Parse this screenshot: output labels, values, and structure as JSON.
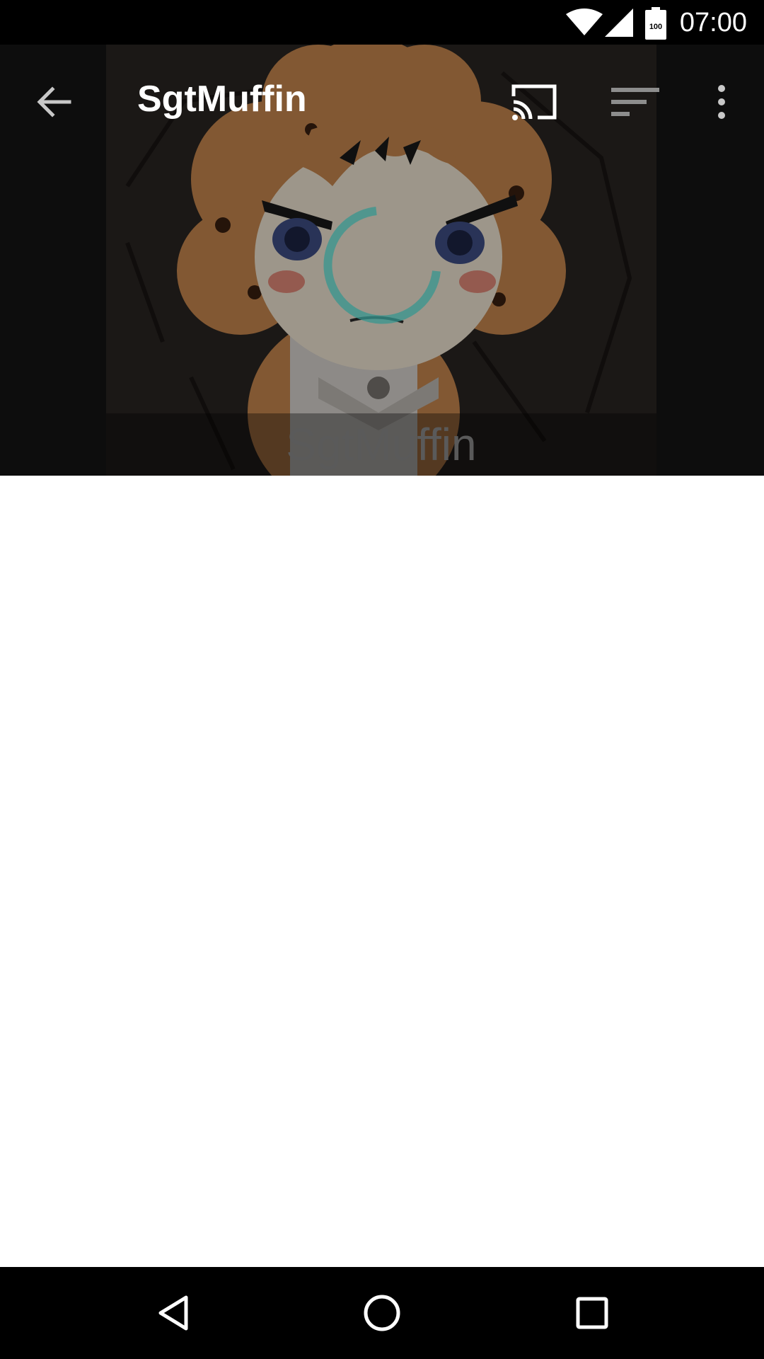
{
  "status_bar": {
    "time": "07:00",
    "battery_level": "100"
  },
  "toolbar": {
    "title": "SgtMuffin"
  },
  "hero": {
    "caption": "SgtMuffin"
  },
  "colors": {
    "spinner_accent": "#37958f",
    "status_bar_bg": "#000000",
    "nav_bar_bg": "#000000"
  },
  "icons": [
    "wifi-icon",
    "cell-signal-icon",
    "battery-icon",
    "back-arrow-icon",
    "cast-icon",
    "sort-icon",
    "more-vert-icon",
    "nav-back-icon",
    "nav-home-icon",
    "nav-recents-icon"
  ]
}
